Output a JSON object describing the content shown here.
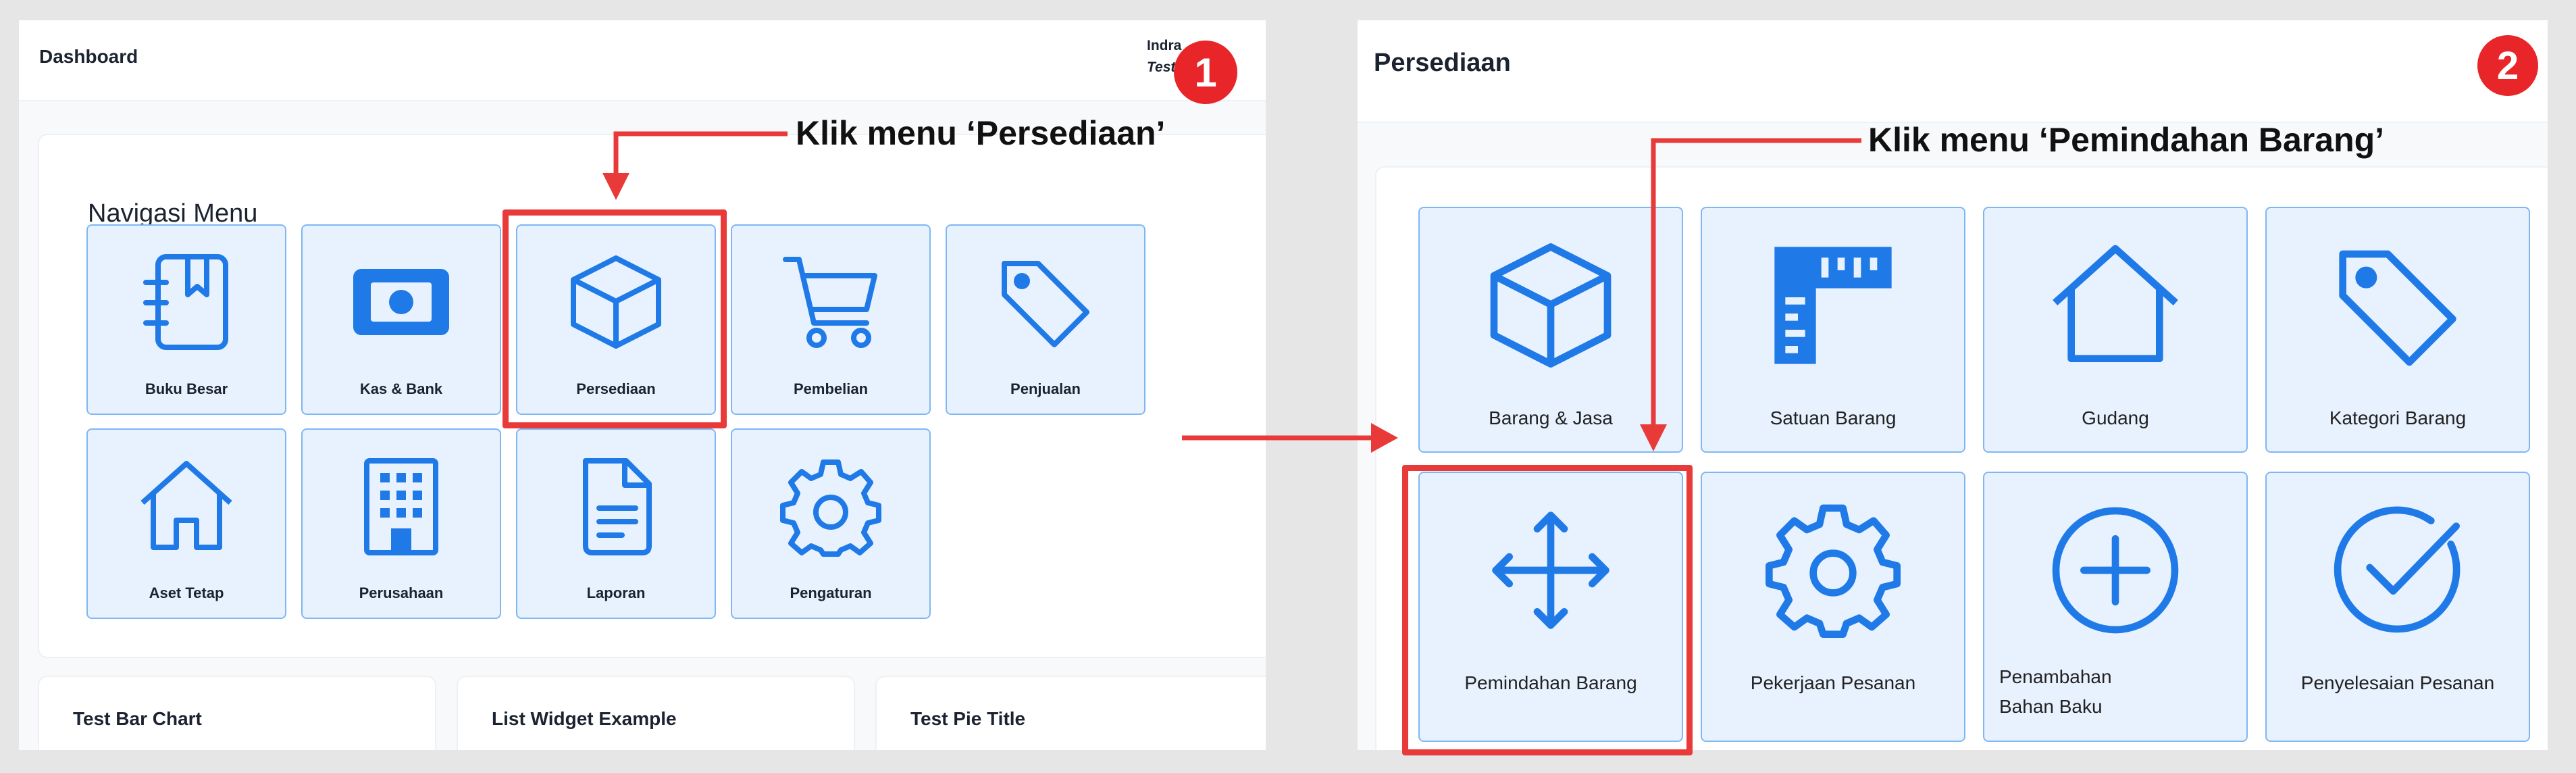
{
  "step1": {
    "badge": "1",
    "header_title": "Dashboard",
    "user_name": "Indra",
    "user_role": "Testi",
    "section_title": "Navigasi Menu",
    "annotation": "Klik menu ‘Persediaan’",
    "tiles": [
      {
        "label": "Buku Besar",
        "icon": "book-icon"
      },
      {
        "label": "Kas & Bank",
        "icon": "cash-icon"
      },
      {
        "label": "Persediaan",
        "icon": "box-icon"
      },
      {
        "label": "Pembelian",
        "icon": "cart-icon"
      },
      {
        "label": "Penjualan",
        "icon": "tag-icon"
      },
      {
        "label": "Aset Tetap",
        "icon": "home-icon"
      },
      {
        "label": "Perusahaan",
        "icon": "building-icon"
      },
      {
        "label": "Laporan",
        "icon": "document-icon"
      },
      {
        "label": "Pengaturan",
        "icon": "gear-icon"
      }
    ],
    "widgets": [
      "Test Bar Chart",
      "List Widget Example",
      "Test Pie Title"
    ]
  },
  "step2": {
    "badge": "2",
    "header_title": "Persediaan",
    "annotation": "Klik menu ‘Pemindahan Barang’",
    "tiles": [
      {
        "label": "Barang & Jasa",
        "icon": "box-icon"
      },
      {
        "label": "Satuan Barang",
        "icon": "ruler-icon"
      },
      {
        "label": "Gudang",
        "icon": "home-icon"
      },
      {
        "label": "Kategori Barang",
        "icon": "tag-icon"
      },
      {
        "label": "Pemindahan Barang",
        "icon": "move-arrows-icon"
      },
      {
        "label": "Pekerjaan Pesanan",
        "icon": "gear-icon"
      },
      {
        "label": "Penambahan Bahan Baku",
        "icon": "plus-circle-icon"
      },
      {
        "label": "Penyelesaian Pesanan",
        "icon": "check-circle-icon"
      }
    ]
  },
  "colors": {
    "accent": "#1f7ae8",
    "tile_bg": "#e8f2fe",
    "tile_border": "#7fb7f3",
    "highlight": "#e93a3a"
  }
}
